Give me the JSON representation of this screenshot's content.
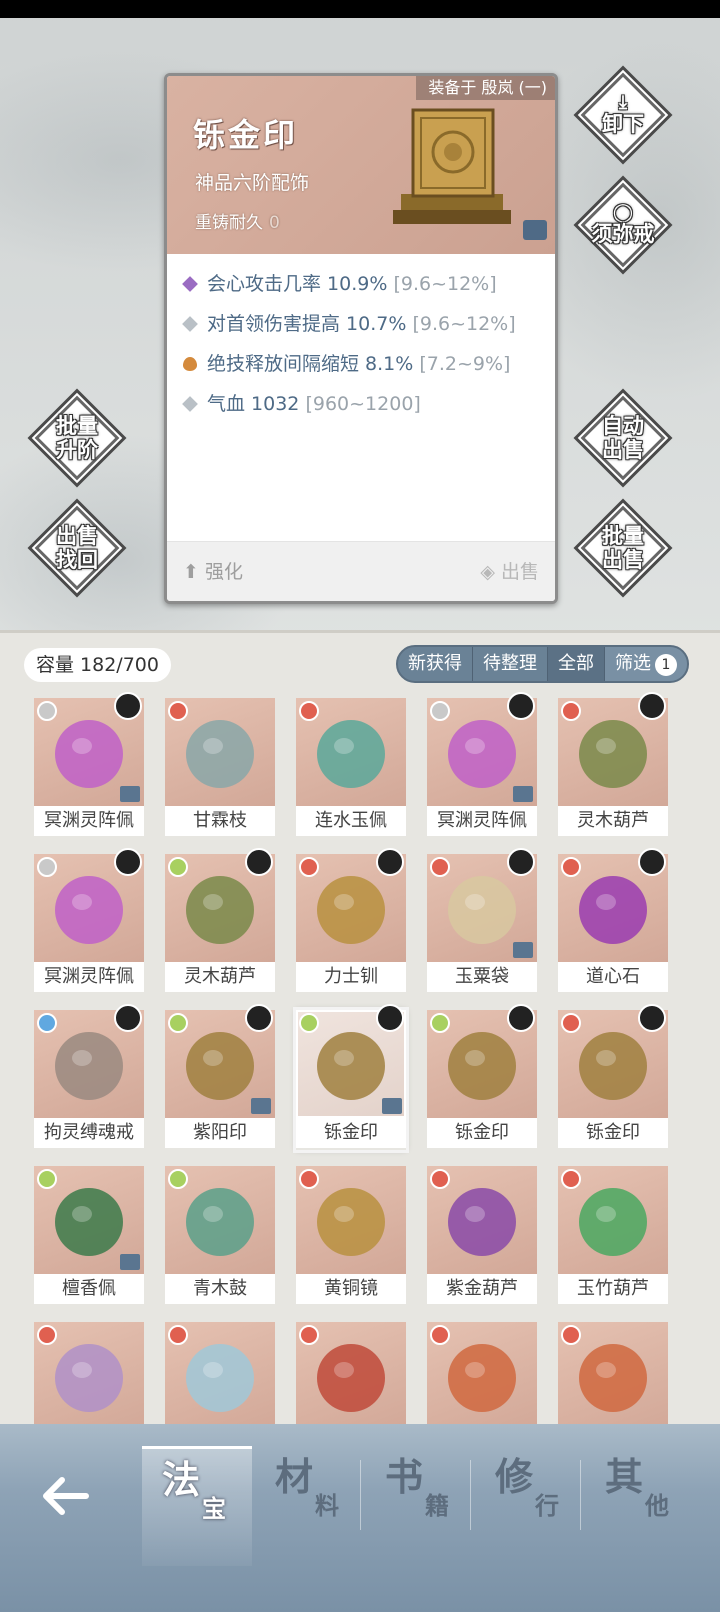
{
  "detail": {
    "equipped_to": "装备于 殷岚 (一)",
    "name": "铄金印",
    "grade": "神品六阶配饰",
    "reforge_label": "重铸耐久",
    "reforge_value": "0",
    "stats": [
      {
        "text": "会心攻击几率 10.9%",
        "range": "[9.6~12%]",
        "mark_color": "#9a6cc2"
      },
      {
        "text": "对首领伤害提高 10.7%",
        "range": "[9.6~12%]",
        "mark_color": "#b9c0c6"
      },
      {
        "text": "绝技释放间隔缩短 8.1%",
        "range": "[7.2~9%]",
        "mark_color": "#d48a3c"
      },
      {
        "text": "气血 1032",
        "range": "[960~1200]",
        "mark_color": "#b9c0c6"
      }
    ],
    "upgrade_label": "强化",
    "sell_label": "出售"
  },
  "side_buttons": {
    "unequip": "卸下",
    "sumeru_1": "须弥",
    "sumeru_2": "戒",
    "batch_upgrade_1": "批量",
    "batch_upgrade_2": "升阶",
    "sell_recover_1": "出售",
    "sell_recover_2": "找回",
    "auto_sell_1": "自动",
    "auto_sell_2": "出售",
    "batch_sell_1": "批量",
    "batch_sell_2": "出售"
  },
  "inventory": {
    "capacity": "容量 182/700",
    "filters": [
      "新获得",
      "待整理",
      "全部",
      "筛选"
    ],
    "filter_badge": "1",
    "items": [
      {
        "name": "冥渊灵阵佩",
        "elem": "#c9c9c9",
        "art": "#c060c8"
      },
      {
        "name": "甘霖枝",
        "elem": "#e06050",
        "art": "#8aa7a8"
      },
      {
        "name": "连水玉佩",
        "elem": "#e06050",
        "art": "#5aa89a"
      },
      {
        "name": "冥渊灵阵佩",
        "elem": "#c9c9c9",
        "art": "#c060c8"
      },
      {
        "name": "灵木葫芦",
        "elem": "#e06050",
        "art": "#7a8a4a"
      },
      {
        "name": "冥渊灵阵佩",
        "elem": "#c9c9c9",
        "art": "#c060c8"
      },
      {
        "name": "灵木葫芦",
        "elem": "#a8d060",
        "art": "#7a8a4a"
      },
      {
        "name": "力士钏",
        "elem": "#e06050",
        "art": "#b89040"
      },
      {
        "name": "玉粟袋",
        "elem": "#e06050",
        "art": "#d8c8a0"
      },
      {
        "name": "道心石",
        "elem": "#e06050",
        "art": "#9a3cb0"
      },
      {
        "name": "拘灵缚魂戒",
        "elem": "#60a8e0",
        "art": "#9a8a80"
      },
      {
        "name": "紫阳印",
        "elem": "#a8d060",
        "art": "#a08040"
      },
      {
        "name": "铄金印",
        "elem": "#a8d060",
        "art": "#a08040"
      },
      {
        "name": "铄金印",
        "elem": "#a8d060",
        "art": "#a08040"
      },
      {
        "name": "铄金印",
        "elem": "#e06050",
        "art": "#a08040"
      },
      {
        "name": "檀香佩",
        "elem": "#a8d060",
        "art": "#3c7a4a"
      },
      {
        "name": "青木鼓",
        "elem": "#a8d060",
        "art": "#5aa08a"
      },
      {
        "name": "黄铜镜",
        "elem": "#e06050",
        "art": "#b89040"
      },
      {
        "name": "紫金葫芦",
        "elem": "#e06050",
        "art": "#8a4aa8"
      },
      {
        "name": "玉竹葫芦",
        "elem": "#e06050",
        "art": "#4aa860"
      },
      {
        "name": "",
        "elem": "#e06050",
        "art": "#b090c8"
      },
      {
        "name": "",
        "elem": "#e06050",
        "art": "#a0c8d8"
      },
      {
        "name": "",
        "elem": "#e06050",
        "art": "#c04a3a"
      },
      {
        "name": "",
        "elem": "#e06050",
        "art": "#d06840"
      },
      {
        "name": "",
        "elem": "#e06050",
        "art": "#d06840"
      }
    ]
  },
  "nav": {
    "tabs": [
      {
        "big": "法",
        "small": "宝"
      },
      {
        "big": "材",
        "small": "料"
      },
      {
        "big": "书",
        "small": "籍"
      },
      {
        "big": "修",
        "small": "行"
      },
      {
        "big": "其",
        "small": "他"
      }
    ]
  },
  "colors": {
    "accent": "#5b7185",
    "card_header": "#d3a898",
    "stat_text": "#4e6a86"
  }
}
